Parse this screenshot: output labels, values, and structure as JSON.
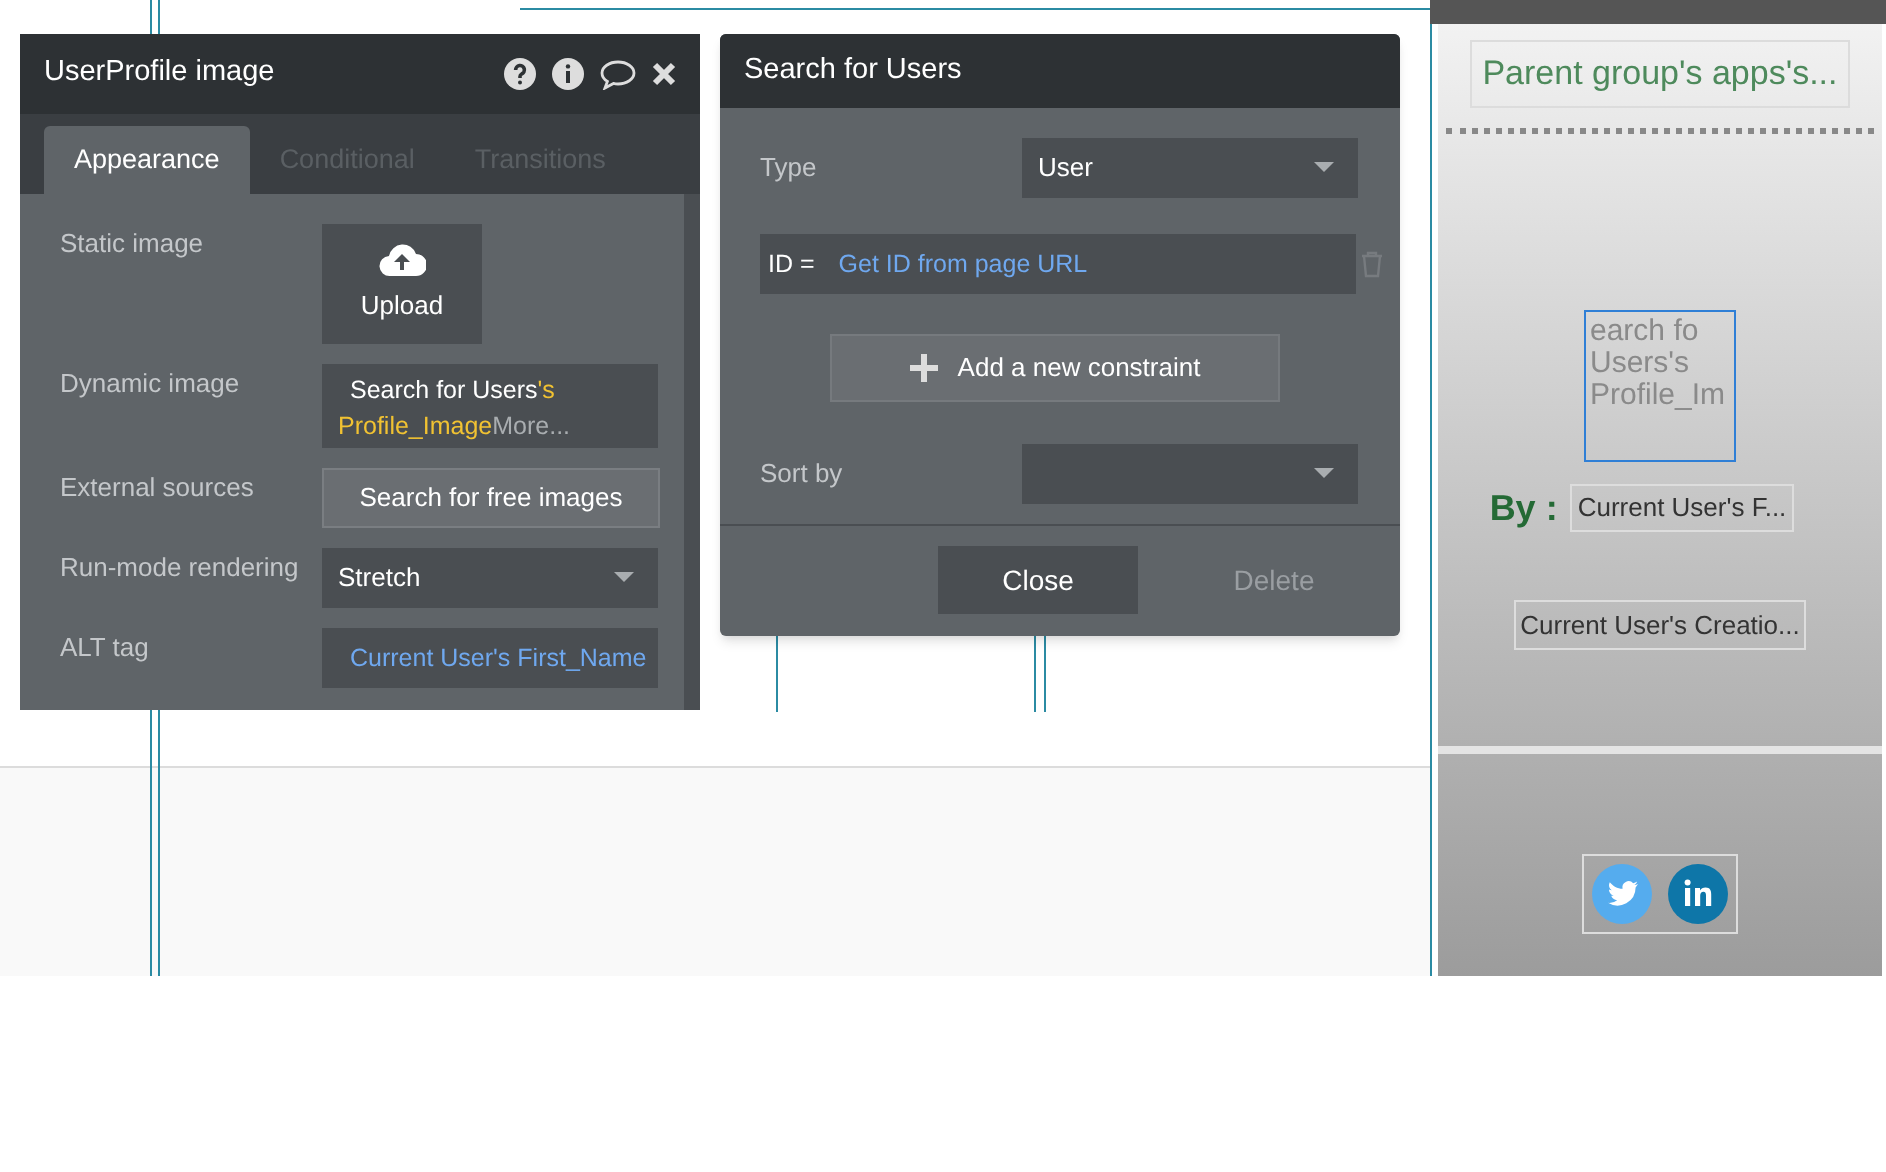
{
  "property_editor": {
    "title": "UserProfile image",
    "tabs": [
      {
        "label": "Appearance",
        "selected": true
      },
      {
        "label": "Conditional",
        "selected": false
      },
      {
        "label": "Transitions",
        "selected": false
      }
    ],
    "rows": [
      {
        "kind": "upload",
        "label": "Static image",
        "button": "Upload"
      },
      {
        "kind": "expression",
        "label": "Dynamic image",
        "parts": [
          {
            "kind": "source",
            "text": "Search for Users"
          },
          {
            "kind": "field",
            "text": "'s Profile_Image"
          },
          {
            "kind": "more",
            "text": "More..."
          }
        ]
      },
      {
        "kind": "button",
        "label": "External sources",
        "button": "Search for free images"
      },
      {
        "kind": "select",
        "label": "Run-mode rendering",
        "value": "Stretch"
      },
      {
        "kind": "link",
        "label": "ALT tag",
        "value": "Current User's First_Name"
      }
    ]
  },
  "search_editor": {
    "title": "Search for Users",
    "type_label": "Type",
    "type_value": "User",
    "constraint": {
      "key": "ID =",
      "value": "Get ID from page URL"
    },
    "add_button": "Add a new constraint",
    "sort_label": "Sort by",
    "buttons": [
      {
        "label": "Close",
        "disabled": false
      },
      {
        "label": "Delete",
        "disabled": true
      }
    ]
  },
  "preview": {
    "title": "Parent group's apps's...",
    "image_text": [
      "earch fo",
      "Users's",
      "Profile_Im"
    ],
    "by_label": "By :",
    "author": "Current User's F...",
    "date": "Current User's Creatio..."
  }
}
